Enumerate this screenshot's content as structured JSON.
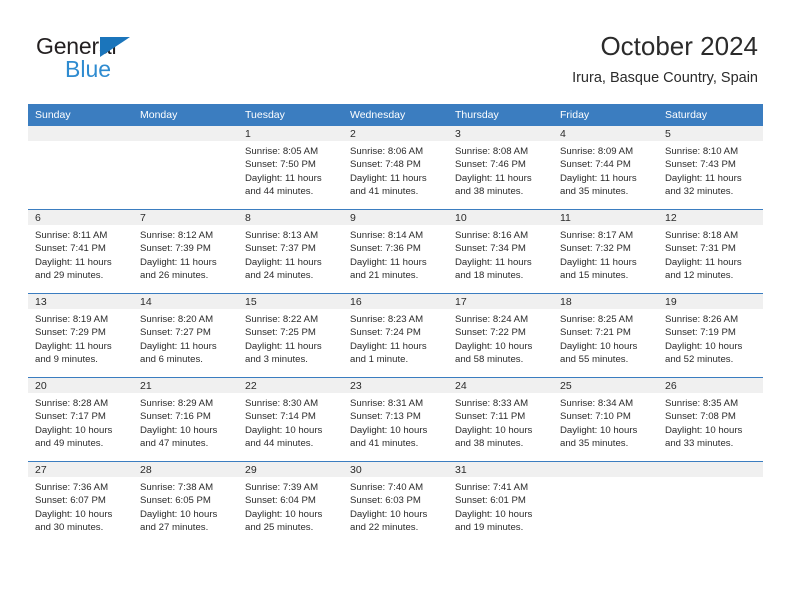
{
  "brand": {
    "name_part1": "General",
    "name_part2": "Blue"
  },
  "header": {
    "title": "October 2024",
    "subtitle": "Irura, Basque Country, Spain"
  },
  "colors": {
    "header_blue": "#3b7dc0",
    "logo_blue": "#2e8bd0",
    "triangle_blue": "#1b75bb",
    "daynum_band": "#f0f0f0",
    "text": "#2b2b2b"
  },
  "weekday_headers": [
    "Sunday",
    "Monday",
    "Tuesday",
    "Wednesday",
    "Thursday",
    "Friday",
    "Saturday"
  ],
  "weeks": [
    [
      {
        "day": "",
        "sunrise": "",
        "sunset": "",
        "daylight": "",
        "blank": true
      },
      {
        "day": "",
        "sunrise": "",
        "sunset": "",
        "daylight": "",
        "blank": true
      },
      {
        "day": "1",
        "sunrise": "Sunrise: 8:05 AM",
        "sunset": "Sunset: 7:50 PM",
        "daylight": "Daylight: 11 hours and 44 minutes."
      },
      {
        "day": "2",
        "sunrise": "Sunrise: 8:06 AM",
        "sunset": "Sunset: 7:48 PM",
        "daylight": "Daylight: 11 hours and 41 minutes."
      },
      {
        "day": "3",
        "sunrise": "Sunrise: 8:08 AM",
        "sunset": "Sunset: 7:46 PM",
        "daylight": "Daylight: 11 hours and 38 minutes."
      },
      {
        "day": "4",
        "sunrise": "Sunrise: 8:09 AM",
        "sunset": "Sunset: 7:44 PM",
        "daylight": "Daylight: 11 hours and 35 minutes."
      },
      {
        "day": "5",
        "sunrise": "Sunrise: 8:10 AM",
        "sunset": "Sunset: 7:43 PM",
        "daylight": "Daylight: 11 hours and 32 minutes."
      }
    ],
    [
      {
        "day": "6",
        "sunrise": "Sunrise: 8:11 AM",
        "sunset": "Sunset: 7:41 PM",
        "daylight": "Daylight: 11 hours and 29 minutes."
      },
      {
        "day": "7",
        "sunrise": "Sunrise: 8:12 AM",
        "sunset": "Sunset: 7:39 PM",
        "daylight": "Daylight: 11 hours and 26 minutes."
      },
      {
        "day": "8",
        "sunrise": "Sunrise: 8:13 AM",
        "sunset": "Sunset: 7:37 PM",
        "daylight": "Daylight: 11 hours and 24 minutes."
      },
      {
        "day": "9",
        "sunrise": "Sunrise: 8:14 AM",
        "sunset": "Sunset: 7:36 PM",
        "daylight": "Daylight: 11 hours and 21 minutes."
      },
      {
        "day": "10",
        "sunrise": "Sunrise: 8:16 AM",
        "sunset": "Sunset: 7:34 PM",
        "daylight": "Daylight: 11 hours and 18 minutes."
      },
      {
        "day": "11",
        "sunrise": "Sunrise: 8:17 AM",
        "sunset": "Sunset: 7:32 PM",
        "daylight": "Daylight: 11 hours and 15 minutes."
      },
      {
        "day": "12",
        "sunrise": "Sunrise: 8:18 AM",
        "sunset": "Sunset: 7:31 PM",
        "daylight": "Daylight: 11 hours and 12 minutes."
      }
    ],
    [
      {
        "day": "13",
        "sunrise": "Sunrise: 8:19 AM",
        "sunset": "Sunset: 7:29 PM",
        "daylight": "Daylight: 11 hours and 9 minutes."
      },
      {
        "day": "14",
        "sunrise": "Sunrise: 8:20 AM",
        "sunset": "Sunset: 7:27 PM",
        "daylight": "Daylight: 11 hours and 6 minutes."
      },
      {
        "day": "15",
        "sunrise": "Sunrise: 8:22 AM",
        "sunset": "Sunset: 7:25 PM",
        "daylight": "Daylight: 11 hours and 3 minutes."
      },
      {
        "day": "16",
        "sunrise": "Sunrise: 8:23 AM",
        "sunset": "Sunset: 7:24 PM",
        "daylight": "Daylight: 11 hours and 1 minute."
      },
      {
        "day": "17",
        "sunrise": "Sunrise: 8:24 AM",
        "sunset": "Sunset: 7:22 PM",
        "daylight": "Daylight: 10 hours and 58 minutes."
      },
      {
        "day": "18",
        "sunrise": "Sunrise: 8:25 AM",
        "sunset": "Sunset: 7:21 PM",
        "daylight": "Daylight: 10 hours and 55 minutes."
      },
      {
        "day": "19",
        "sunrise": "Sunrise: 8:26 AM",
        "sunset": "Sunset: 7:19 PM",
        "daylight": "Daylight: 10 hours and 52 minutes."
      }
    ],
    [
      {
        "day": "20",
        "sunrise": "Sunrise: 8:28 AM",
        "sunset": "Sunset: 7:17 PM",
        "daylight": "Daylight: 10 hours and 49 minutes."
      },
      {
        "day": "21",
        "sunrise": "Sunrise: 8:29 AM",
        "sunset": "Sunset: 7:16 PM",
        "daylight": "Daylight: 10 hours and 47 minutes."
      },
      {
        "day": "22",
        "sunrise": "Sunrise: 8:30 AM",
        "sunset": "Sunset: 7:14 PM",
        "daylight": "Daylight: 10 hours and 44 minutes."
      },
      {
        "day": "23",
        "sunrise": "Sunrise: 8:31 AM",
        "sunset": "Sunset: 7:13 PM",
        "daylight": "Daylight: 10 hours and 41 minutes."
      },
      {
        "day": "24",
        "sunrise": "Sunrise: 8:33 AM",
        "sunset": "Sunset: 7:11 PM",
        "daylight": "Daylight: 10 hours and 38 minutes."
      },
      {
        "day": "25",
        "sunrise": "Sunrise: 8:34 AM",
        "sunset": "Sunset: 7:10 PM",
        "daylight": "Daylight: 10 hours and 35 minutes."
      },
      {
        "day": "26",
        "sunrise": "Sunrise: 8:35 AM",
        "sunset": "Sunset: 7:08 PM",
        "daylight": "Daylight: 10 hours and 33 minutes."
      }
    ],
    [
      {
        "day": "27",
        "sunrise": "Sunrise: 7:36 AM",
        "sunset": "Sunset: 6:07 PM",
        "daylight": "Daylight: 10 hours and 30 minutes."
      },
      {
        "day": "28",
        "sunrise": "Sunrise: 7:38 AM",
        "sunset": "Sunset: 6:05 PM",
        "daylight": "Daylight: 10 hours and 27 minutes."
      },
      {
        "day": "29",
        "sunrise": "Sunrise: 7:39 AM",
        "sunset": "Sunset: 6:04 PM",
        "daylight": "Daylight: 10 hours and 25 minutes."
      },
      {
        "day": "30",
        "sunrise": "Sunrise: 7:40 AM",
        "sunset": "Sunset: 6:03 PM",
        "daylight": "Daylight: 10 hours and 22 minutes."
      },
      {
        "day": "31",
        "sunrise": "Sunrise: 7:41 AM",
        "sunset": "Sunset: 6:01 PM",
        "daylight": "Daylight: 10 hours and 19 minutes."
      },
      {
        "day": "",
        "sunrise": "",
        "sunset": "",
        "daylight": "",
        "blank": true
      },
      {
        "day": "",
        "sunrise": "",
        "sunset": "",
        "daylight": "",
        "blank": true
      }
    ]
  ]
}
